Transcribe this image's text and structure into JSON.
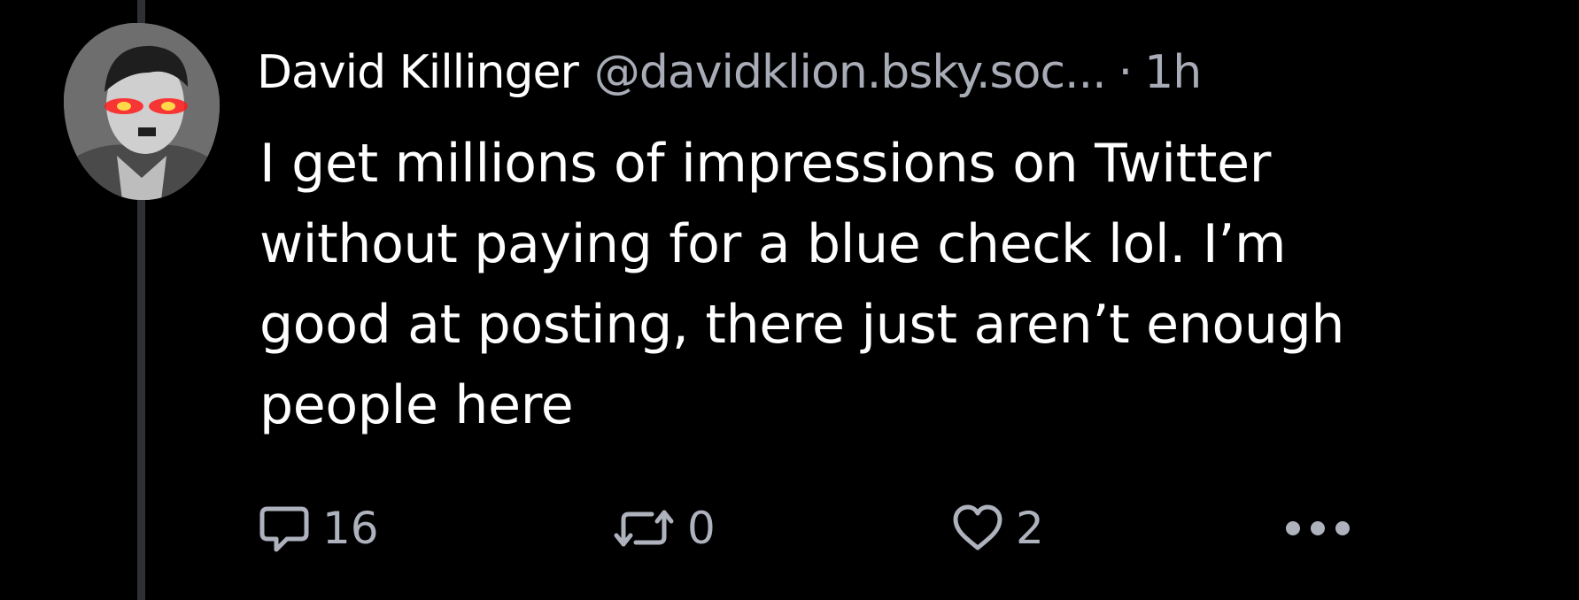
{
  "post": {
    "display_name": "David Killinger",
    "handle": "@davidklion.bsky.soc...",
    "separator": "·",
    "time": "1h",
    "text": "I get millions of impressions on Twitter\nwithout paying for a blue check lol. I’m\ngood at posting, there just aren’t enough\npeople here"
  },
  "actions": {
    "reply": {
      "icon": "reply-bubble-icon",
      "count": "16"
    },
    "repost": {
      "icon": "repost-arrows-icon",
      "count": "0"
    },
    "like": {
      "icon": "heart-outline-icon",
      "count": "2"
    },
    "more": {
      "icon": "more-dots-icon"
    }
  },
  "colors": {
    "background": "#000000",
    "text": "#ffffff",
    "muted": "#a8acb6",
    "thread_line": "#2e3035",
    "avatar_eyes": "#ff1a1a"
  }
}
